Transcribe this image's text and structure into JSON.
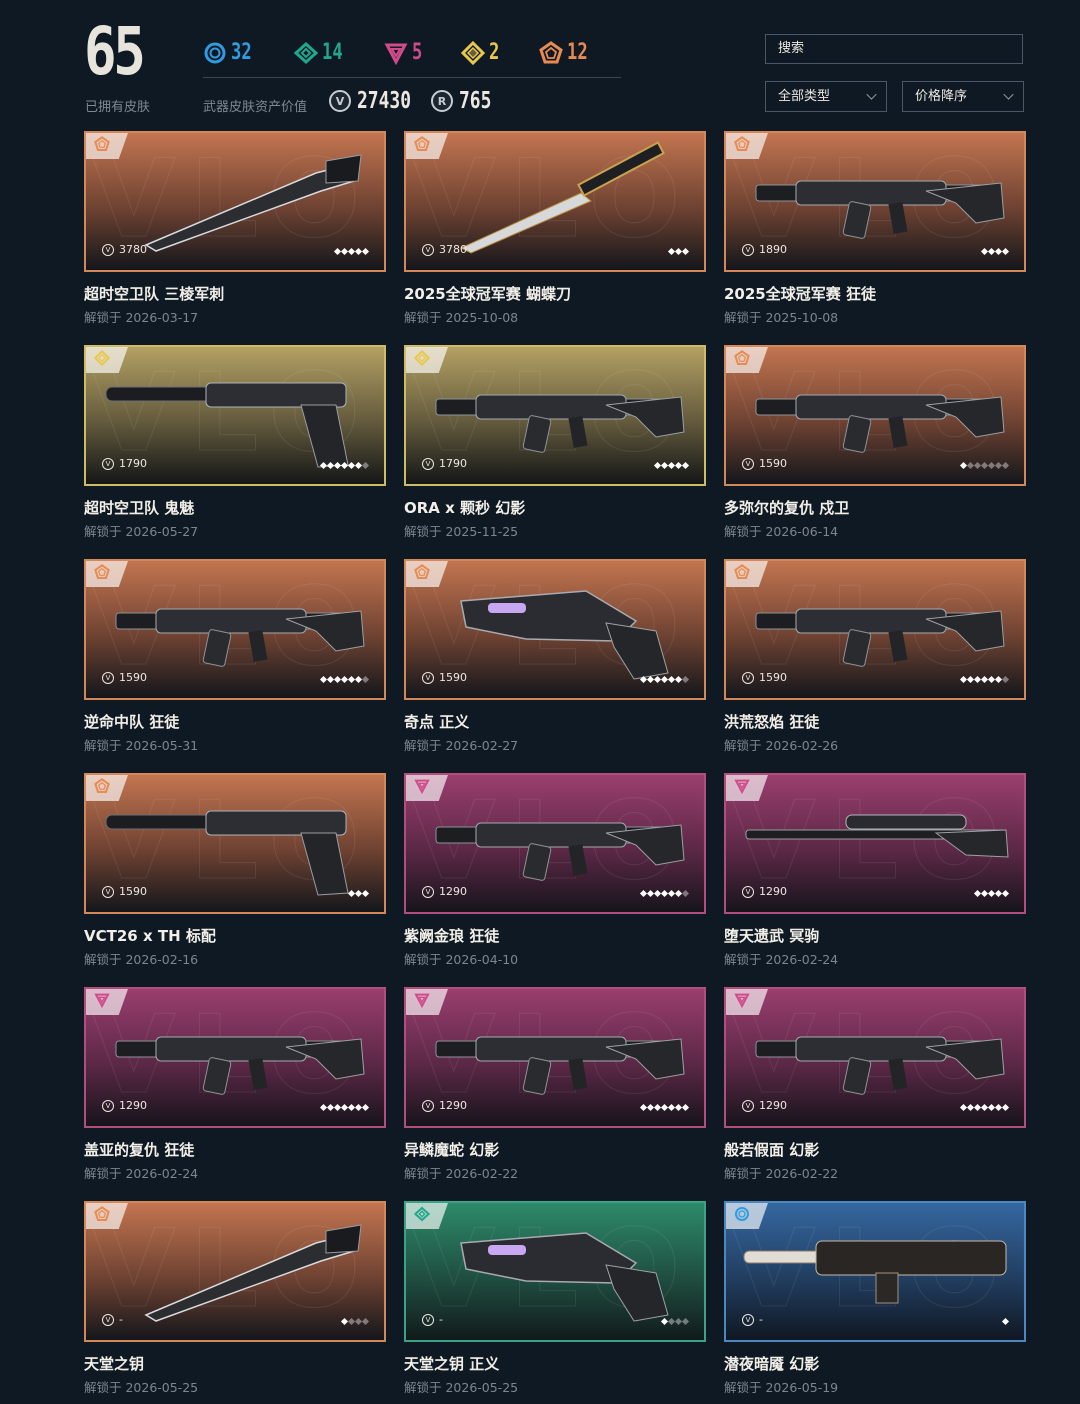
{
  "header": {
    "owned_count": "65",
    "owned_label": "已拥有皮肤",
    "value_label": "武器皮肤资产价值",
    "tiers": [
      {
        "icon": "select-tier-icon",
        "count": "32",
        "color": "#2f9be0"
      },
      {
        "icon": "deluxe-tier-icon",
        "count": "14",
        "color": "#1fa88a"
      },
      {
        "icon": "premium-tier-icon",
        "count": "5",
        "color": "#d14b8a"
      },
      {
        "icon": "ultra-tier-icon",
        "count": "2",
        "color": "#e8c84a"
      },
      {
        "icon": "exclusive-tier-icon",
        "count": "12",
        "color": "#e88a52"
      }
    ],
    "vp_symbol": "V",
    "vp_value": "27430",
    "rp_symbol": "R",
    "rp_value": "765",
    "search_placeholder": "搜索",
    "type_filter": "全部类型",
    "sort_filter": "价格降序"
  },
  "skins": [
    {
      "name": "超时空卫队 三棱军刺",
      "date": "解锁于 2026-03-17",
      "price": "3780",
      "tier": "exclusive",
      "levels": 5,
      "levels_on": 5,
      "weapon": "knife"
    },
    {
      "name": "2025全球冠军赛 蝴蝶刀",
      "date": "解锁于 2025-10-08",
      "price": "3780",
      "tier": "exclusive",
      "levels": 3,
      "levels_on": 3,
      "weapon": "butterfly"
    },
    {
      "name": "2025全球冠军赛 狂徒",
      "date": "解锁于 2025-10-08",
      "price": "1890",
      "tier": "exclusive",
      "levels": 4,
      "levels_on": 4,
      "weapon": "rifle"
    },
    {
      "name": "超时空卫队 鬼魅",
      "date": "解锁于 2026-05-27",
      "price": "1790",
      "tier": "ultra",
      "levels": 7,
      "levels_on": 6,
      "weapon": "pistol"
    },
    {
      "name": "ORA x 颗秒 幻影",
      "date": "解锁于 2025-11-25",
      "price": "1790",
      "tier": "ultra",
      "levels": 5,
      "levels_on": 5,
      "weapon": "rifle"
    },
    {
      "name": "多弥尔的复仇 戍卫",
      "date": "解锁于 2026-06-14",
      "price": "1590",
      "tier": "exclusive",
      "levels": 7,
      "levels_on": 1,
      "weapon": "rifle"
    },
    {
      "name": "逆命中队 狂徒",
      "date": "解锁于 2026-05-31",
      "price": "1590",
      "tier": "exclusive",
      "levels": 7,
      "levels_on": 6,
      "weapon": "rifle"
    },
    {
      "name": "奇点 正义",
      "date": "解锁于 2026-02-27",
      "price": "1590",
      "tier": "exclusive",
      "levels": 7,
      "levels_on": 6,
      "weapon": "revolver"
    },
    {
      "name": "洪荒怒焰 狂徒",
      "date": "解锁于 2026-02-26",
      "price": "1590",
      "tier": "exclusive",
      "levels": 7,
      "levels_on": 6,
      "weapon": "rifle"
    },
    {
      "name": "VCT26 x TH 标配",
      "date": "解锁于 2026-02-16",
      "price": "1590",
      "tier": "exclusive",
      "levels": 3,
      "levels_on": 3,
      "weapon": "pistol"
    },
    {
      "name": "紫阙金琅 狂徒",
      "date": "解锁于 2026-04-10",
      "price": "1290",
      "tier": "premium",
      "levels": 7,
      "levels_on": 6,
      "weapon": "rifle"
    },
    {
      "name": "堕天遗武 冥驹",
      "date": "解锁于 2026-02-24",
      "price": "1290",
      "tier": "premium",
      "levels": 5,
      "levels_on": 5,
      "weapon": "sniper"
    },
    {
      "name": "盖亚的复仇 狂徒",
      "date": "解锁于 2026-02-24",
      "price": "1290",
      "tier": "premium",
      "levels": 7,
      "levels_on": 7,
      "weapon": "rifle"
    },
    {
      "name": "异鳞魔蛇 幻影",
      "date": "解锁于 2026-02-22",
      "price": "1290",
      "tier": "premium",
      "levels": 7,
      "levels_on": 7,
      "weapon": "rifle"
    },
    {
      "name": "般若假面 幻影",
      "date": "解锁于 2026-02-22",
      "price": "1290",
      "tier": "premium",
      "levels": 7,
      "levels_on": 7,
      "weapon": "rifle"
    },
    {
      "name": "天堂之钥",
      "date": "解锁于 2026-05-25",
      "price": "-",
      "tier": "exclusive",
      "levels": 4,
      "levels_on": 1,
      "weapon": "knife"
    },
    {
      "name": "天堂之钥 正义",
      "date": "解锁于 2026-05-25",
      "price": "-",
      "tier": "deluxe",
      "levels": 4,
      "levels_on": 1,
      "weapon": "revolver"
    },
    {
      "name": "潜夜暗魇 幻影",
      "date": "解锁于 2026-05-19",
      "price": "-",
      "tier": "select",
      "levels": 1,
      "levels_on": 1,
      "weapon": "smg"
    }
  ]
}
